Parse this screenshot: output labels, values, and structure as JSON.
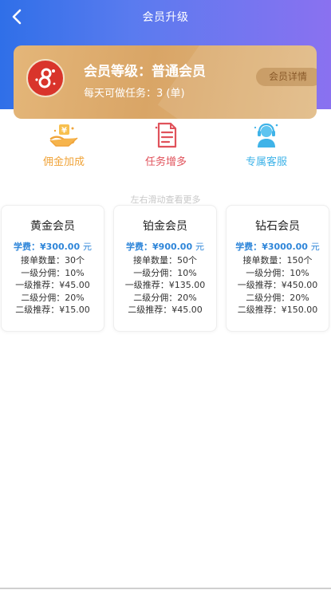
{
  "header": {
    "title": "会员升级"
  },
  "card": {
    "level_text": "会员等级：普通会员",
    "tasks_text": "每天可做任务：3 (单)",
    "detail_label": "会员详情"
  },
  "features": [
    {
      "label": "佣金加成",
      "icon": "money-hand-icon"
    },
    {
      "label": "任务增多",
      "icon": "document-list-icon"
    },
    {
      "label": "专属客服",
      "icon": "customer-service-icon"
    }
  ],
  "hint": "左右滑动查看更多",
  "plans": [
    {
      "name": "黄金会员",
      "fee_label": "学费：",
      "fee_value": "¥300.00",
      "fee_unit": "元",
      "lines": [
        "接单数量：30个",
        "一级分佣：10%",
        "一级推荐：¥45.00",
        "二级分佣：20%",
        "二级推荐：¥15.00"
      ]
    },
    {
      "name": "铂金会员",
      "fee_label": "学费：",
      "fee_value": "¥900.00",
      "fee_unit": "元",
      "lines": [
        "接单数量：50个",
        "一级分佣：10%",
        "一级推荐：¥135.00",
        "二级分佣：20%",
        "二级推荐：¥45.00"
      ]
    },
    {
      "name": "钻石会员",
      "fee_label": "学费：",
      "fee_value": "¥3000.00",
      "fee_unit": "元",
      "lines": [
        "接单数量：150个",
        "一级分佣：10%",
        "一级推荐：¥450.00",
        "二级分佣：20%",
        "二级推荐：¥150.00"
      ]
    }
  ],
  "colors": {
    "header_gradient_start": "#2f6fe8",
    "header_gradient_end": "#8a71f0",
    "card_gold": "#d9a566",
    "fee_blue": "#2f86d9",
    "feature_orange": "#f0a43a",
    "feature_red": "#e0525b",
    "feature_blue": "#3fb3e8"
  }
}
